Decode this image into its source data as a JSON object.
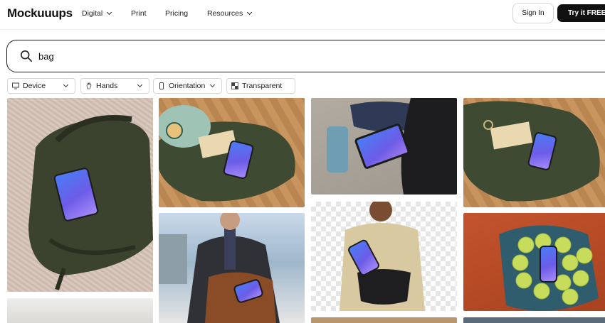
{
  "header": {
    "logo": "Mockuuups",
    "nav": [
      {
        "label": "Digital",
        "has_dropdown": true
      },
      {
        "label": "Print",
        "has_dropdown": false
      },
      {
        "label": "Pricing",
        "has_dropdown": false
      },
      {
        "label": "Resources",
        "has_dropdown": true
      }
    ],
    "sign_in_label": "Sign In",
    "try_label": "Try it FREE"
  },
  "search": {
    "value": "bag",
    "icon": "search-icon"
  },
  "filters": [
    {
      "label": "Device",
      "icon": "monitor-icon",
      "has_dropdown": true
    },
    {
      "label": "Hands",
      "icon": "hand-icon",
      "has_dropdown": true
    },
    {
      "label": "Orientation",
      "icon": "phone-orientation-icon",
      "has_dropdown": true
    },
    {
      "label": "Transparent",
      "icon": "checkerboard-icon",
      "has_dropdown": false
    }
  ],
  "colors": {
    "accent_dark": "#111111",
    "border": "#d6d6d6",
    "screen_gradient_start": "#4a7cf5",
    "screen_gradient_end": "#a78bfa"
  }
}
